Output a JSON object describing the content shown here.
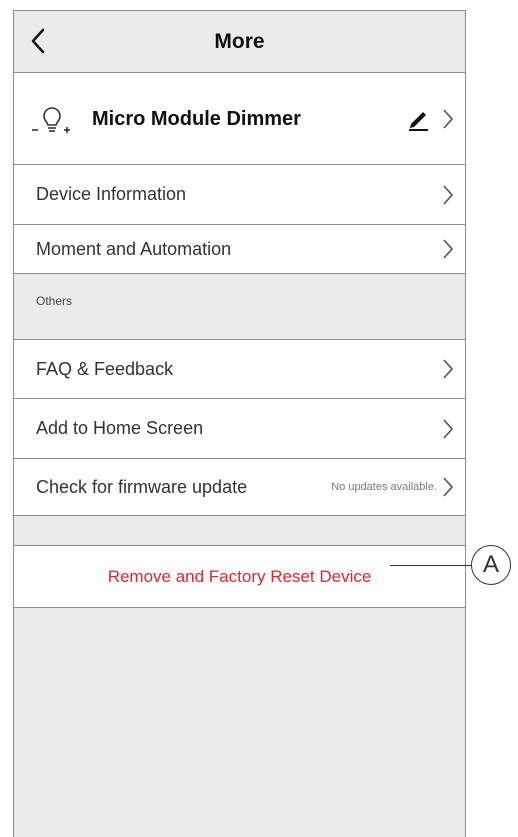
{
  "header": {
    "title": "More"
  },
  "device": {
    "name": "Micro Module Dimmer"
  },
  "menu": {
    "device_information": "Device Information",
    "moment_automation": "Moment and Automation"
  },
  "others": {
    "section_label": "Others",
    "faq": "FAQ & Feedback",
    "add_home": "Add to Home Screen",
    "firmware": "Check for firmware update",
    "firmware_status": "No updates available."
  },
  "remove": {
    "label": "Remove and Factory Reset Device"
  },
  "callout": {
    "letter": "A"
  },
  "colors": {
    "danger": "#e4262b",
    "background": "#ebebeb",
    "divider": "#8c8c8c"
  }
}
